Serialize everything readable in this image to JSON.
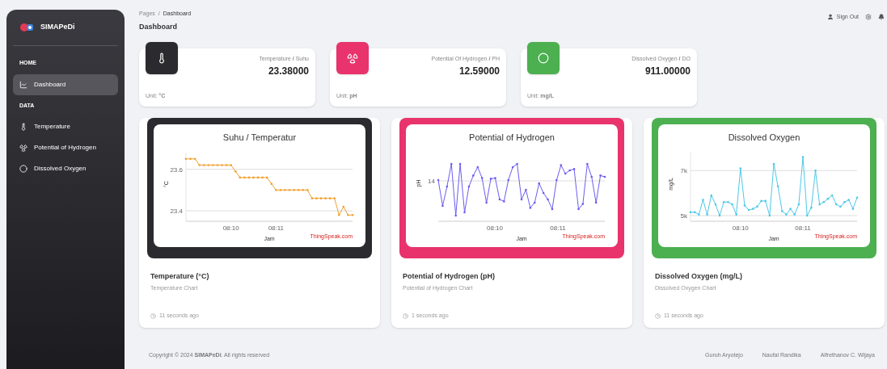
{
  "sidebar": {
    "brand": "SIMAPeDi",
    "sections": [
      {
        "heading": "HOME",
        "items": [
          {
            "label": "Dashboard",
            "selected": true
          }
        ]
      },
      {
        "heading": "DATA",
        "items": [
          {
            "label": "Temperature",
            "selected": false
          },
          {
            "label": "Potential of Hydrogen",
            "selected": false
          },
          {
            "label": "Dissolved Oxygen",
            "selected": false
          }
        ]
      }
    ]
  },
  "header": {
    "breadcrumb": [
      "Pages",
      "/",
      "Dashboard"
    ],
    "title": "Dashboard",
    "sign_out": "Sign Out"
  },
  "stats": [
    {
      "color": "#2b2b2f",
      "label": "Temperature **/** Suhu",
      "value": "23.38000",
      "unit": "Unit: **°C**"
    },
    {
      "color": "#e8336d",
      "label": "Potential Of Hydrogen **/** PH",
      "value": "12.59000",
      "unit": "Unit: **pH**"
    },
    {
      "color": "#4caf50",
      "label": "Dissolved Oxygen **/** DO",
      "value": "911.00000",
      "unit": "Unit: **mg/L**"
    }
  ],
  "chart_cards": [
    {
      "color": "#2b2b2f",
      "kind": "chart",
      "credit": "ThingSpeak.com",
      "title": "Temperature (°C)",
      "subtitle": "Temperature Chart",
      "time": "11 seconds ago",
      "chart_data": {
        "type": "line",
        "title": "Suhu / Temperatur",
        "xlabel": "Jam",
        "ylabel": "°C",
        "categories": [
          null,
          null,
          null,
          null,
          null,
          null,
          null,
          null,
          null,
          null,
          "08:10",
          null,
          null,
          null,
          null,
          null,
          null,
          null,
          null,
          null,
          "08:11",
          null,
          null,
          null,
          null,
          null,
          null,
          null,
          null,
          null,
          null,
          null,
          null,
          null,
          null,
          null,
          null,
          null
        ],
        "series": [
          {
            "color": "#f0a030",
            "values": [
              23.65,
              23.65,
              23.65,
              23.62,
              23.62,
              23.62,
              23.62,
              23.62,
              23.62,
              23.62,
              23.62,
              23.59,
              23.56,
              23.56,
              23.56,
              23.56,
              23.56,
              23.56,
              23.56,
              23.53,
              23.5,
              23.5,
              23.5,
              23.5,
              23.5,
              23.5,
              23.5,
              23.5,
              23.46,
              23.46,
              23.46,
              23.46,
              23.46,
              23.46,
              23.38,
              23.42,
              23.38,
              23.38
            ]
          }
        ],
        "ylim": [
          23.35,
          23.68
        ],
        "yticks": [
          {
            "value": 23.4,
            "label": "23.4"
          },
          {
            "value": 23.6,
            "label": "23.6"
          }
        ]
      }
    },
    {
      "color": "#e8336d",
      "kind": "picture",
      "credit": "ThingSpeak.com",
      "title": "Potential of Hydrogen (pH)",
      "subtitle": "Potential of Hydrogen Chart",
      "time": "1 seconds ago",
      "picture": {
        "title": "Potential of Hydrogen",
        "xlabel": "Jam",
        "ylabel": "pH",
        "ytick": "14",
        "xticks": [
          "08:10",
          "08:11"
        ]
      }
    },
    {
      "color": "#4caf50",
      "kind": "chart",
      "credit": "ThingSpeak.com",
      "title": "Dissolved Oxygen (mg/L)",
      "subtitle": "Dissolved Oxygen Chart",
      "time": "11 seconds ago",
      "chart_data": {
        "type": "line",
        "title": "Dissolved Oxygen",
        "xlabel": "Jam",
        "ylabel": "mg/L",
        "categories": [
          null,
          null,
          null,
          null,
          null,
          null,
          null,
          null,
          null,
          null,
          null,
          null,
          "08:10",
          null,
          null,
          null,
          null,
          null,
          null,
          null,
          null,
          null,
          null,
          null,
          null,
          null,
          null,
          "08:11",
          null,
          null,
          null,
          null,
          null,
          null,
          null,
          null,
          null,
          null,
          null,
          null,
          null
        ],
        "series": [
          {
            "color": "#4dc8e8",
            "values": [
              5150,
              5150,
              5050,
              5700,
              5050,
              5900,
              5500,
              5000,
              5600,
              5600,
              5500,
              5050,
              7100,
              5450,
              5250,
              5300,
              5400,
              5650,
              5650,
              5000,
              7300,
              6300,
              5200,
              5050,
              5300,
              5050,
              5500,
              7600,
              5000,
              5350,
              7000,
              5500,
              5600,
              5750,
              5900,
              5500,
              5400,
              5600,
              5700,
              5300,
              5800
            ]
          }
        ],
        "ylim": [
          4750,
          7800
        ],
        "yticks": [
          {
            "value": 5000,
            "label": "5k"
          },
          {
            "value": 7000,
            "label": "7k"
          }
        ]
      }
    }
  ],
  "footer": {
    "copyright": "Copyright © 2024 **SIMAPeDi**. All rights reserved",
    "links": [
      "Guruh Aryotejo",
      "Naufal Randika",
      "Alfrethanov C. Wijaya"
    ]
  }
}
